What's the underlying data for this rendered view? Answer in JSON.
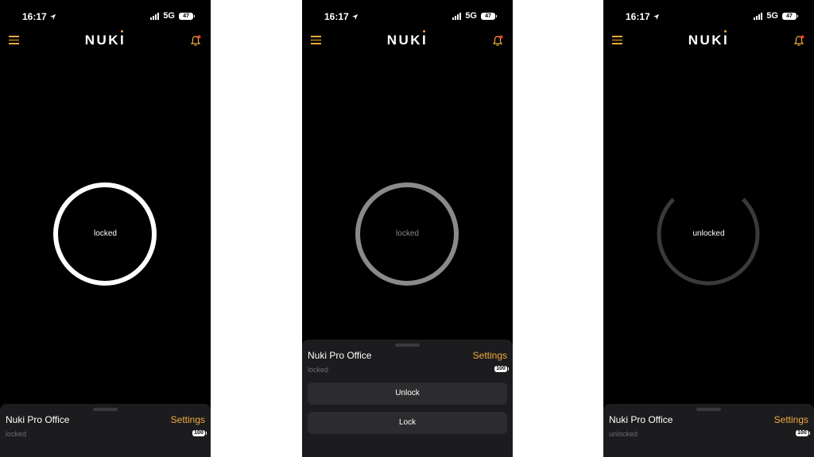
{
  "status_bar": {
    "time": "16:17",
    "network": "5G",
    "battery": "47"
  },
  "app": {
    "logo": "NUKI",
    "accent": "#f2a93b"
  },
  "screens": [
    {
      "ring_state": "locked",
      "sheet": {
        "device_name": "Nuki Pro Office",
        "settings_label": "Settings",
        "state": "locked",
        "battery": "100"
      }
    },
    {
      "ring_state": "locked",
      "sheet": {
        "device_name": "Nuki Pro Office",
        "settings_label": "Settings",
        "state": "locked",
        "battery": "100",
        "unlock_label": "Unlock",
        "lock_label": "Lock"
      }
    },
    {
      "ring_state": "unlocked",
      "sheet": {
        "device_name": "Nuki Pro Office",
        "settings_label": "Settings",
        "state": "unlocked",
        "battery": "100"
      }
    }
  ]
}
